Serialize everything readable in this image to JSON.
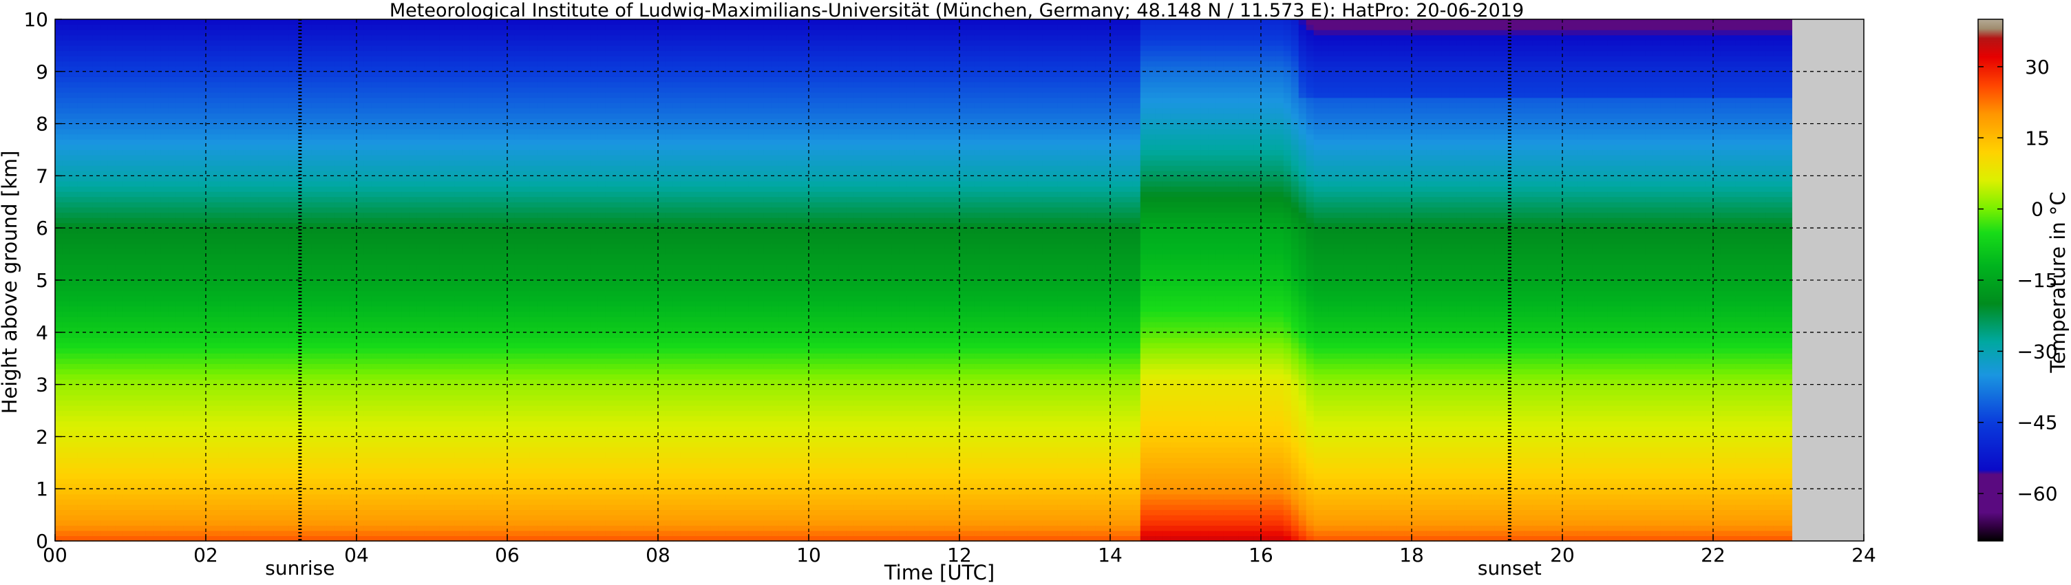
{
  "chart_data": {
    "type": "heatmap",
    "title": "Meteorological Institute of Ludwig-Maximilians-Universität (München, Germany; 48.148 N / 11.573 E):    HatPro: 20-06-2019",
    "xlabel": "Time [UTC]",
    "ylabel": "Height above ground [km]",
    "xlim": [
      0,
      24
    ],
    "ylim": [
      0,
      10
    ],
    "x_ticks": [
      "00",
      "02",
      "04",
      "06",
      "08",
      "10",
      "12",
      "14",
      "16",
      "18",
      "20",
      "22",
      "24"
    ],
    "y_ticks": [
      "0",
      "1",
      "2",
      "3",
      "4",
      "5",
      "6",
      "7",
      "8",
      "9",
      "10"
    ],
    "grid": true,
    "data_end_hour": 23.05,
    "nodata_color": "#c8c8c8",
    "sunrise": {
      "label": "sunrise",
      "hour": 3.25
    },
    "sunset": {
      "label": "sunset",
      "hour": 19.3
    },
    "temperature_profile_c": {
      "heights_km": [
        0,
        0.3,
        1,
        2,
        3,
        4,
        5,
        6,
        7,
        8,
        9,
        10
      ],
      "values": [
        25,
        20,
        14,
        7,
        2,
        -8,
        -15,
        -20,
        -30,
        -38,
        -45,
        -55
      ]
    },
    "warm_event": {
      "start_hour": 14.45,
      "end_hour": 16.3,
      "peak_surface_c": 30,
      "warming_c": 6
    },
    "colorbar": {
      "label": "Temperature in °C",
      "vmin": -70,
      "vmax": 40,
      "ticks": [
        "30",
        "15",
        "0",
        "−15",
        "−30",
        "−45",
        "−60"
      ],
      "tick_values": [
        30,
        15,
        0,
        -15,
        -30,
        -45,
        -60
      ],
      "colors": [
        {
          "t": -70,
          "color": "#000000"
        },
        {
          "t": -67,
          "color": "#300040"
        },
        {
          "t": -64,
          "color": "#5a0a80"
        },
        {
          "t": -56,
          "color": "#5a0a80"
        },
        {
          "t": -55,
          "color": "#0a0ac8"
        },
        {
          "t": -45,
          "color": "#0a3cdc"
        },
        {
          "t": -35,
          "color": "#1a96e0"
        },
        {
          "t": -28,
          "color": "#00a8a0"
        },
        {
          "t": -20,
          "color": "#008c1e"
        },
        {
          "t": -12,
          "color": "#00b41e"
        },
        {
          "t": -5,
          "color": "#18dc18"
        },
        {
          "t": 0,
          "color": "#78f000"
        },
        {
          "t": 6,
          "color": "#dcf000"
        },
        {
          "t": 12,
          "color": "#ffd200"
        },
        {
          "t": 20,
          "color": "#ff9600"
        },
        {
          "t": 26,
          "color": "#ff4600"
        },
        {
          "t": 32,
          "color": "#e60000"
        },
        {
          "t": 36,
          "color": "#b41414"
        },
        {
          "t": 38,
          "color": "#a08c6e"
        },
        {
          "t": 40,
          "color": "#b4aa96"
        }
      ]
    }
  }
}
